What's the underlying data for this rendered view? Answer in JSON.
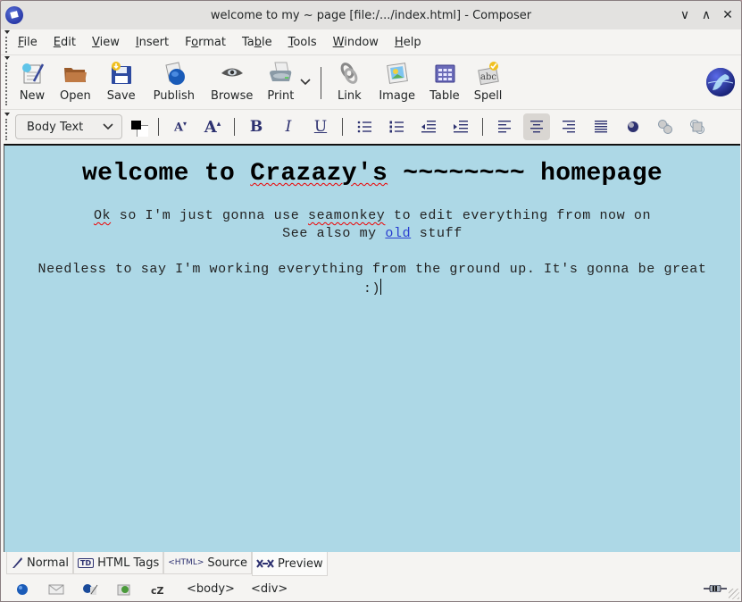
{
  "window": {
    "title": "welcome to my ~ page [file:/.../index.html] - Composer",
    "controls": {
      "minimize": "∨",
      "maximize": "∧",
      "close": "✕"
    }
  },
  "menubar": {
    "items": [
      {
        "label": "File",
        "mnemonic": "F",
        "rest": "ile"
      },
      {
        "label": "Edit",
        "mnemonic": "E",
        "rest": "dit"
      },
      {
        "label": "View",
        "mnemonic": "V",
        "rest": "iew"
      },
      {
        "label": "Insert",
        "mnemonic": "I",
        "rest": "nsert"
      },
      {
        "label": "Format",
        "pre": "F",
        "mnemonic": "o",
        "rest": "rmat"
      },
      {
        "label": "Table",
        "pre": "Ta",
        "mnemonic": "b",
        "rest": "le"
      },
      {
        "label": "Tools",
        "mnemonic": "T",
        "rest": "ools"
      },
      {
        "label": "Window",
        "mnemonic": "W",
        "rest": "indow"
      },
      {
        "label": "Help",
        "mnemonic": "H",
        "rest": "elp"
      }
    ]
  },
  "toolbar": {
    "new": "New",
    "open": "Open",
    "save": "Save",
    "publish": "Publish",
    "browse": "Browse",
    "print": "Print",
    "print_more": "⌄",
    "link": "Link",
    "image": "Image",
    "table": "Table",
    "spell": "Spell"
  },
  "format_toolbar": {
    "paragraph_style": "Body Text",
    "text_color": "#000000",
    "background_color": "#ffffff",
    "bold": "B",
    "italic": "I",
    "underline": "U",
    "active_alignment": "center"
  },
  "document": {
    "background": "#add8e6",
    "heading_pre": "welcome to ",
    "heading_misspelled": "Crazazy's",
    "heading_post": " ~~~~~~~~ homepage",
    "line1_misspelled_a": "Ok",
    "line1_mid": " so I'm just gonna use ",
    "line1_misspelled_b": "seamonkey",
    "line1_post": " to edit everything from now on",
    "line2_pre": "See also my ",
    "line2_link": "old",
    "line2_post": " stuff",
    "para2_line1": "Needless to say I'm working everything from the ground up. It's gonna be great",
    "para2_line2": ":)"
  },
  "view_tabs": [
    {
      "label": "Normal"
    },
    {
      "label": "HTML Tags",
      "icon_text": "TD"
    },
    {
      "label": "Source",
      "icon_text": "<HTML>"
    },
    {
      "label": "Preview",
      "active": true
    }
  ],
  "statusbar": {
    "breadcrumbs": [
      "<body>",
      "<div>"
    ]
  }
}
